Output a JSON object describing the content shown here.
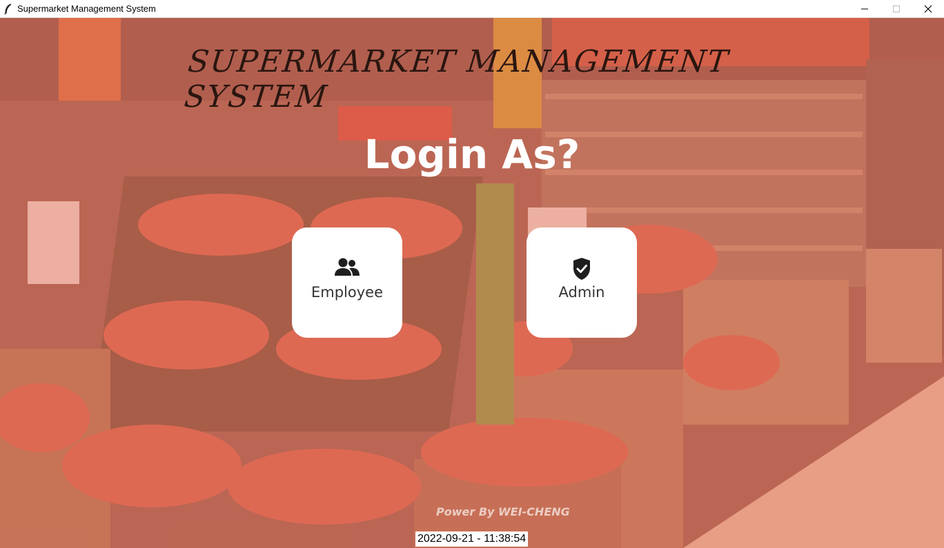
{
  "window": {
    "title": "Supermarket Management System",
    "icons": {
      "app": "feather-icon",
      "minimize": "minimize-icon",
      "maximize": "maximize-icon",
      "close": "close-icon"
    }
  },
  "header": {
    "system_title": "SUPERMARKET MANAGEMENT SYSTEM"
  },
  "login": {
    "heading": "Login As?",
    "options": [
      {
        "label": "Employee",
        "icon": "users-icon"
      },
      {
        "label": "Admin",
        "icon": "shield-check-icon"
      }
    ]
  },
  "footer": {
    "powered_by": "Power By WEI-CHENG",
    "datetime": "2022-09-21 - 11:38:54"
  },
  "colors": {
    "overlay": "#e87660",
    "card": "#ffffff",
    "heading": "#ffffff"
  }
}
